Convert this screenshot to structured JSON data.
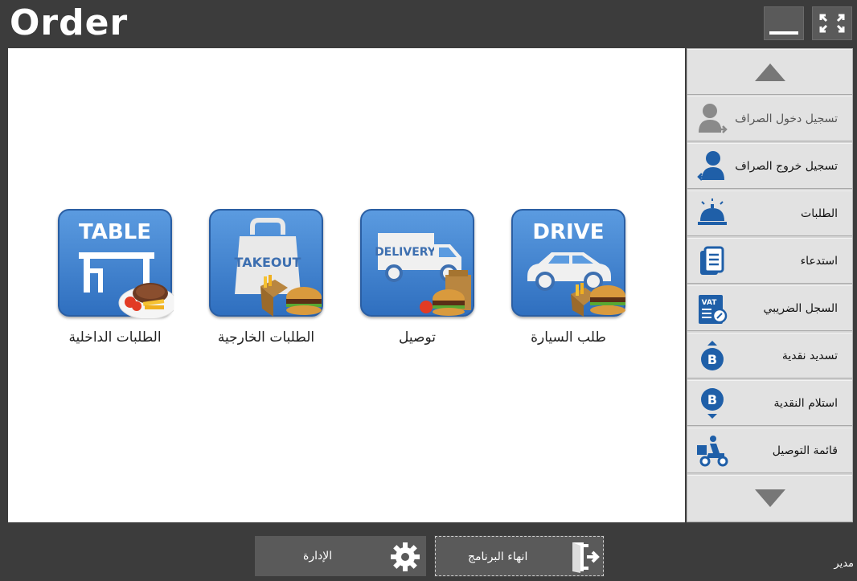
{
  "app": {
    "title": "Order"
  },
  "window": {
    "minimize_icon": "minimize-icon",
    "fullscreen_icon": "fullscreen-icon"
  },
  "tiles": [
    {
      "icon_text": "TABLE",
      "label": "الطلبات الداخلية",
      "icon": "dine-in-icon"
    },
    {
      "icon_text": "TAKEOUT",
      "label": "الطلبات الخارجية",
      "icon": "takeout-icon"
    },
    {
      "icon_text": "DELIVERY",
      "label": "توصيل",
      "icon": "delivery-truck-icon"
    },
    {
      "icon_text": "DRIVE",
      "label": "طلب السيارة",
      "icon": "drive-thru-icon"
    }
  ],
  "sidebar": {
    "scroll_up_icon": "triangle-up-icon",
    "scroll_down_icon": "triangle-down-icon",
    "items": [
      {
        "label": "تسجيل دخول الصراف",
        "icon": "cashier-login-icon",
        "enabled": false
      },
      {
        "label": "تسجيل خروج الصراف",
        "icon": "cashier-logout-icon",
        "enabled": true
      },
      {
        "label": "الطلبات",
        "icon": "service-bell-icon",
        "enabled": true
      },
      {
        "label": "استدعاء",
        "icon": "recall-document-icon",
        "enabled": true
      },
      {
        "label": "السجل الضريبي",
        "icon": "vat-register-icon",
        "enabled": true
      },
      {
        "label": "تسديد نقدية",
        "icon": "cash-payout-icon",
        "enabled": true
      },
      {
        "label": "استلام النقدية",
        "icon": "cash-receive-icon",
        "enabled": true
      },
      {
        "label": "قائمة التوصيل",
        "icon": "delivery-scooter-icon",
        "enabled": true
      }
    ]
  },
  "bottom": {
    "admin_label": "الإدارة",
    "admin_icon": "gear-icon",
    "exit_label": "انهاء البرنامج",
    "exit_icon": "exit-door-icon",
    "user_label": "مدير"
  },
  "colors": {
    "tile_blue": "#3f82d4",
    "sidebar_icon_blue": "#1f5fa8",
    "background_dark": "#3c3c3c"
  }
}
